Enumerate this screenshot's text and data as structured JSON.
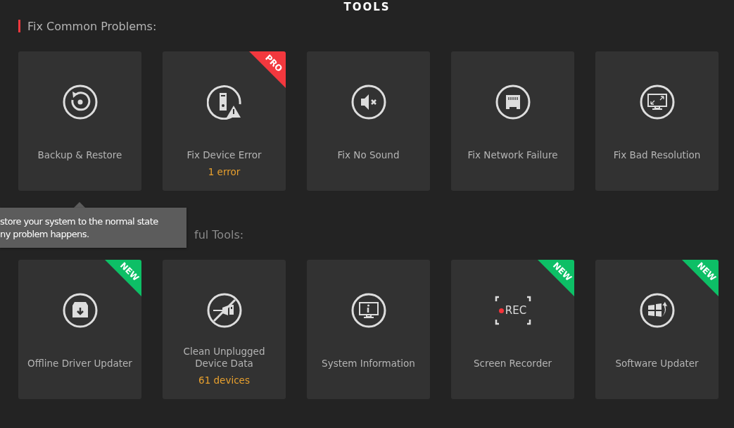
{
  "title": "TOOLS",
  "sections": [
    {
      "heading": "Fix Common Problems:",
      "tools": [
        {
          "label": "Backup & Restore"
        },
        {
          "label": "Fix Device Error",
          "detail": "1 error",
          "badge": {
            "kind": "pro",
            "text": "PRO"
          }
        },
        {
          "label": "Fix No Sound"
        },
        {
          "label": "Fix Network Failure"
        },
        {
          "label": "Fix Bad Resolution"
        }
      ]
    },
    {
      "heading": "ful Tools:",
      "tools": [
        {
          "label": "Offline Driver Updater",
          "badge": {
            "kind": "new",
            "text": "NEW"
          }
        },
        {
          "label": "Clean Unplugged Device Data",
          "detail": "61 devices"
        },
        {
          "label": "System Information"
        },
        {
          "label": "Screen Recorder",
          "icon_text": "REC",
          "badge": {
            "kind": "new",
            "text": "NEW"
          }
        },
        {
          "label": "Software Updater",
          "badge": {
            "kind": "new",
            "text": "NEW"
          }
        }
      ]
    }
  ],
  "tooltip": {
    "text": "store your system to the normal state\nny problem happens."
  }
}
